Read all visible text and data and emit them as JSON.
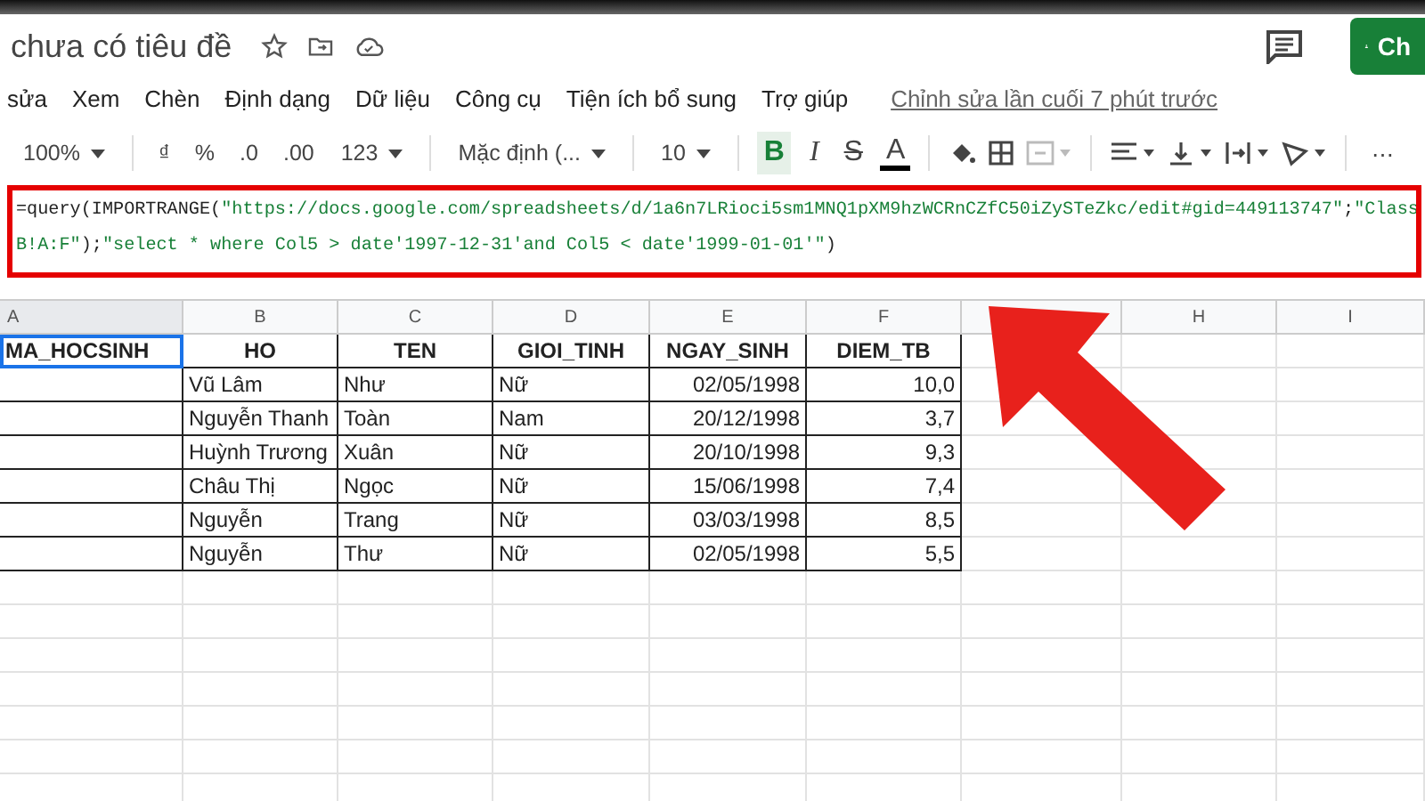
{
  "document": {
    "title": "chưa có tiêu đề"
  },
  "menu": [
    "sửa",
    "Xem",
    "Chèn",
    "Định dạng",
    "Dữ liệu",
    "Công cụ",
    "Tiện ích bổ sung",
    "Trợ giúp"
  ],
  "last_edit": "Chỉnh sửa lần cuối 7 phút trước",
  "share_button": {
    "label": "Ch"
  },
  "toolbar": [
    {
      "kind": "dropdown",
      "label": "100%"
    },
    {
      "kind": "sep"
    },
    {
      "kind": "text",
      "label": "₫"
    },
    {
      "kind": "text",
      "label": "%"
    },
    {
      "kind": "text",
      "label": ".0"
    },
    {
      "kind": "text",
      "label": ".00"
    },
    {
      "kind": "dropdown",
      "label": "123"
    },
    {
      "kind": "sep"
    },
    {
      "kind": "dropdown",
      "label": "Mặc định (..."
    },
    {
      "kind": "sep"
    },
    {
      "kind": "dropdown",
      "label": "10"
    },
    {
      "kind": "sep"
    },
    {
      "kind": "bold",
      "label": "B",
      "selected": true
    },
    {
      "kind": "italic",
      "label": "I",
      "selected": false
    },
    {
      "kind": "strike",
      "label": "S",
      "selected": false
    },
    {
      "kind": "color",
      "label": "A"
    },
    {
      "kind": "sep"
    },
    {
      "kind": "fill"
    },
    {
      "kind": "borders"
    },
    {
      "kind": "merge",
      "disabled": true
    },
    {
      "kind": "sep"
    },
    {
      "kind": "halign"
    },
    {
      "kind": "valign"
    },
    {
      "kind": "wrap"
    },
    {
      "kind": "rotate"
    },
    {
      "kind": "sep"
    },
    {
      "kind": "more",
      "label": "⋯"
    }
  ],
  "formula": [
    [
      {
        "kind": "code",
        "text": "=query(IMPORTRANGE("
      },
      {
        "kind": "string",
        "text": "\"https://docs.google.com/spreadsheets/d/1a6n7LRioci5sm1MNQ1pXM9hzWCRnCZfC50iZySTeZkc/edit#gid=449113747\""
      },
      {
        "kind": "code",
        "text": ";"
      },
      {
        "kind": "string",
        "text": "\"Class"
      }
    ],
    [
      {
        "kind": "string",
        "text": "B!A:F\""
      },
      {
        "kind": "code",
        "text": ");"
      },
      {
        "kind": "string",
        "text": "\"select * where Col5 > date'1997-12-31'and Col5 < date'1999-01-01'\""
      },
      {
        "kind": "code",
        "text": ")"
      }
    ]
  ],
  "columns": [
    {
      "label": "A",
      "selected": true
    },
    {
      "label": "B",
      "selected": false
    },
    {
      "label": "C",
      "selected": false
    },
    {
      "label": "D",
      "selected": false
    },
    {
      "label": "E",
      "selected": false
    },
    {
      "label": "F",
      "selected": false
    },
    {
      "selected": false
    },
    {
      "label": "H",
      "selected": false
    },
    {
      "label": "I",
      "selected": false
    }
  ],
  "rows": [
    [
      "MA_HOCSINH",
      "HO",
      "TEN",
      "GIOI_TINH",
      "NGAY_SINH",
      "DIEM_TB"
    ],
    [
      "",
      "Vũ Lâm",
      "Như",
      "Nữ",
      "02/05/1998",
      "10,0"
    ],
    [
      "",
      "Nguyễn Thanh",
      "Toàn",
      "Nam",
      "20/12/1998",
      "3,7"
    ],
    [
      "",
      "Huỳnh Trương",
      "Xuân",
      "Nữ",
      "20/10/1998",
      "9,3"
    ],
    [
      "",
      "Châu Thị",
      "Ngọc",
      "Nữ",
      "15/06/1998",
      "7,4"
    ],
    [
      "",
      "Nguyễn",
      "Trang",
      "Nữ",
      "03/03/1998",
      "8,5"
    ],
    [
      "",
      "Nguyễn",
      "Thư",
      "Nữ",
      "02/05/1998",
      "5,5"
    ]
  ]
}
